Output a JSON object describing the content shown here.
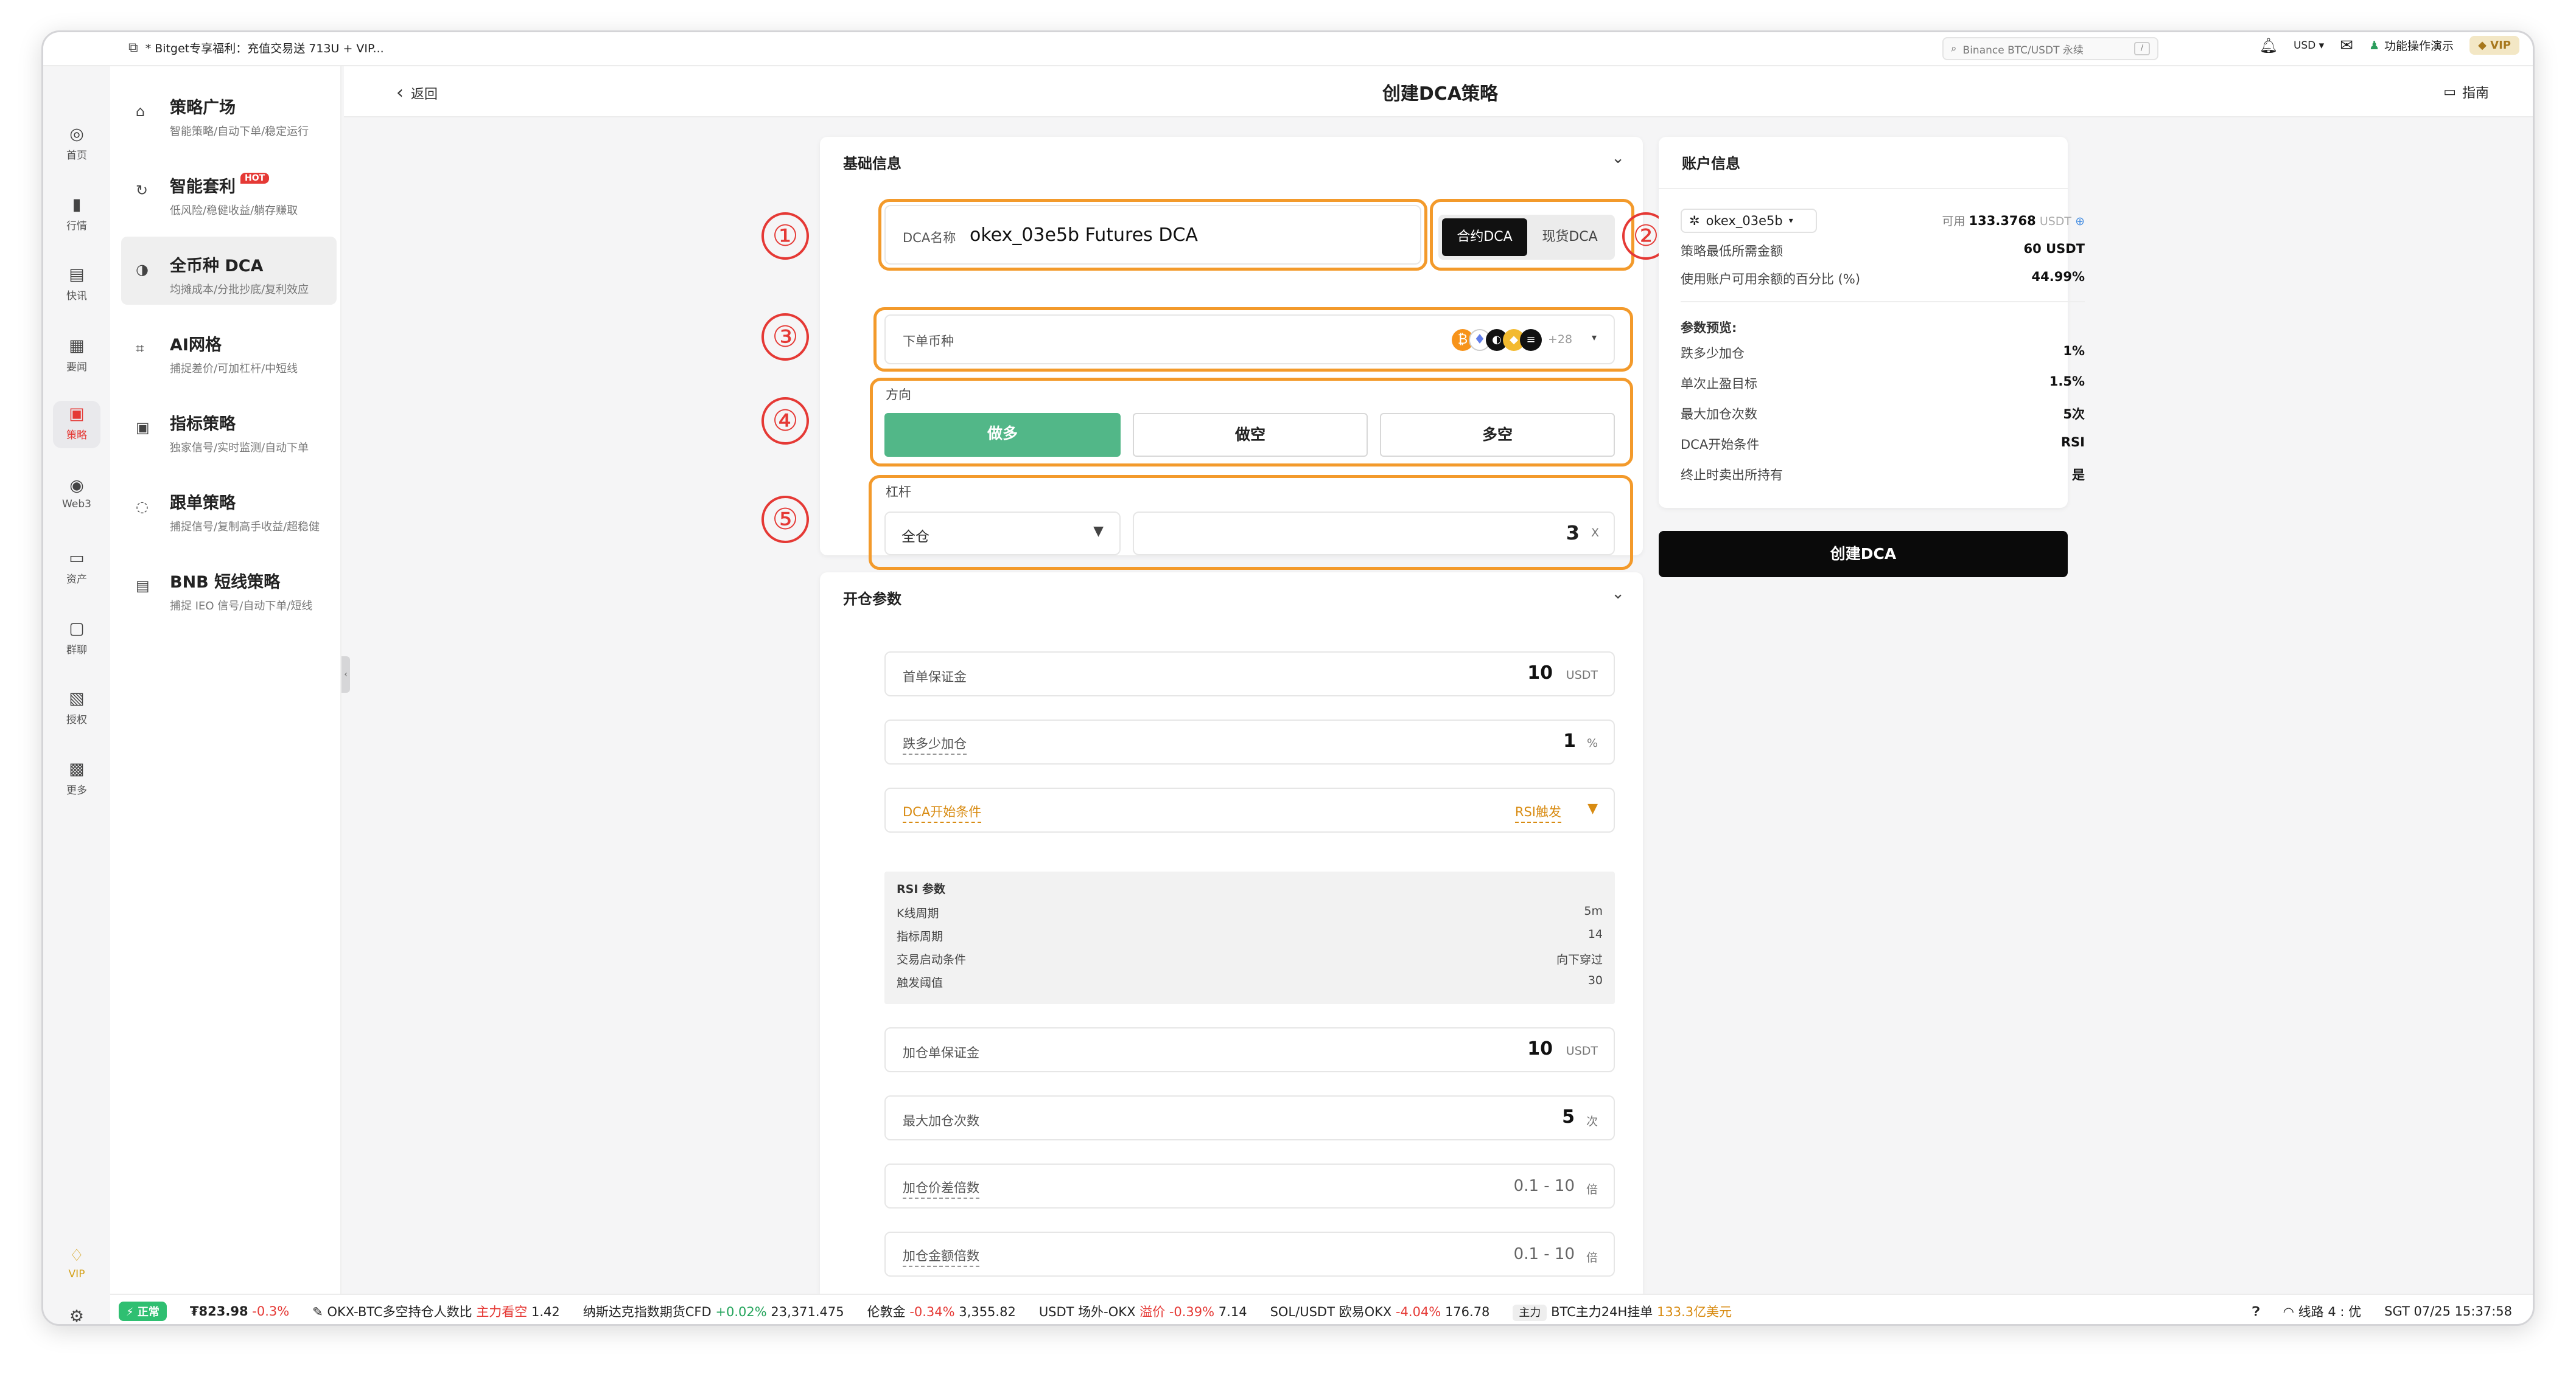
{
  "topbar": {
    "notice": "* Bitget专享福利：充值交易送 713U + VIP...",
    "search_placeholder": "Binance BTC/USDT 永续",
    "search_kbd": "/",
    "currency": "USD",
    "demo": "功能操作演示",
    "vip": "VIP"
  },
  "rail": [
    {
      "icon": "home-icon",
      "glyph": "◎",
      "label": "首页"
    },
    {
      "icon": "market-icon",
      "glyph": "▮",
      "label": "行情"
    },
    {
      "icon": "news-icon",
      "glyph": "▤",
      "label": "快讯"
    },
    {
      "icon": "article-icon",
      "glyph": "▦",
      "label": "要闻"
    },
    {
      "icon": "strategy-icon",
      "glyph": "▣",
      "label": "策略"
    },
    {
      "icon": "web3-icon",
      "glyph": "◉",
      "label": "Web3"
    },
    {
      "icon": "wallet-icon",
      "glyph": "▭",
      "label": "资产"
    },
    {
      "icon": "chat-icon",
      "glyph": "▢",
      "label": "群聊"
    },
    {
      "icon": "auth-icon",
      "glyph": "▧",
      "label": "授权"
    },
    {
      "icon": "more-icon",
      "glyph": "▩",
      "label": "更多"
    }
  ],
  "rail_vip": "VIP",
  "menu": [
    {
      "title": "策略广场",
      "sub": "智能策略/自动下单/稳定运行",
      "hot": ""
    },
    {
      "title": "智能套利",
      "sub": "低风险/稳健收益/躺存赚取",
      "hot": "HOT"
    },
    {
      "title": "全币种 DCA",
      "sub": "均摊成本/分批抄底/复利效应",
      "hot": ""
    },
    {
      "title": "AI网格",
      "sub": "捕捉差价/可加杠杆/中短线",
      "hot": ""
    },
    {
      "title": "指标策略",
      "sub": "独家信号/实时监测/自动下单",
      "hot": ""
    },
    {
      "title": "跟单策略",
      "sub": "捕捉信号/复制高手收益/超稳健",
      "hot": ""
    },
    {
      "title": "BNB 短线策略",
      "sub": "捕捉 IEO 信号/自动下单/短线",
      "hot": ""
    }
  ],
  "header": {
    "back": "返回",
    "title": "创建DCA策略",
    "guide": "指南"
  },
  "basic": {
    "title": "基础信息",
    "name_label": "DCA名称",
    "name_value": "okex_03e5b Futures DCA",
    "type_active": "合约DCA",
    "type_inactive": "现货DCA",
    "coin_label": "下单币种",
    "coin_more": "+28",
    "direction_label": "方向",
    "dir_long": "做多",
    "dir_short": "做空",
    "dir_both": "多空",
    "leverage_label": "杠杆",
    "margin_mode": "全仓",
    "leverage_value": "3",
    "leverage_unit": "X"
  },
  "markers": [
    "①",
    "②",
    "③",
    "④",
    "⑤"
  ],
  "open": {
    "title": "开仓参数",
    "first_margin_label": "首单保证金",
    "first_margin_value": "10",
    "first_margin_unit": "USDT",
    "drop_label": "跌多少加仓",
    "drop_value": "1",
    "drop_unit": "%",
    "start_label": "DCA开始条件",
    "start_value": "RSI触发",
    "rsi_title": "RSI 参数",
    "rsi_rows": [
      {
        "k": "K线周期",
        "v": "5m"
      },
      {
        "k": "指标周期",
        "v": "14"
      },
      {
        "k": "交易启动条件",
        "v": "向下穿过"
      },
      {
        "k": "触发阈值",
        "v": "30"
      }
    ],
    "add_margin_label": "加仓单保证金",
    "add_margin_value": "10",
    "add_margin_unit": "USDT",
    "max_add_label": "最大加仓次数",
    "max_add_value": "5",
    "max_add_unit": "次",
    "price_mult_label": "加仓价差倍数",
    "price_mult_value": "0.1 - 10",
    "price_mult_unit": "倍",
    "amount_mult_label": "加仓金额倍数",
    "amount_mult_value": "0.1 - 10",
    "amount_mult_unit": "倍"
  },
  "account": {
    "title": "账户信息",
    "account_name": "okex_03e5b",
    "available_label": "可用",
    "available_value": "133.3768",
    "available_unit": "USDT",
    "rows": [
      {
        "k": "策略最低所需金额",
        "v": "60 USDT"
      },
      {
        "k": "使用账户可用余额的百分比 (%)",
        "v": "44.99%"
      }
    ],
    "preview_title": "参数预览:",
    "preview": [
      {
        "k": "跌多少加仓",
        "v": "1%"
      },
      {
        "k": "单次止盈目标",
        "v": "1.5%"
      },
      {
        "k": "最大加仓次数",
        "v": "5次"
      },
      {
        "k": "DCA开始条件",
        "v": "RSI"
      },
      {
        "k": "终止时卖出所持有",
        "v": "是"
      }
    ],
    "create_button": "创建DCA"
  },
  "ticker": {
    "status": "正常",
    "price1": "₮823.98",
    "chg1": "-0.3%",
    "item2_name": "OKX-BTC多空持仓人数比",
    "item2_tag": "主力看空",
    "item2_val": "1.42",
    "item3_name": "纳斯达克指数期货CFD",
    "item3_chg": "+0.02%",
    "item3_val": "23,371.475",
    "item4_name": "伦敦金",
    "item4_chg": "-0.34%",
    "item4_val": "3,355.82",
    "item5_name": "USDT 场外-OKX",
    "item5_tag": "溢价 -0.39%",
    "item5_val": "7.14",
    "item6_name": "SOL/USDT 欧易OKX",
    "item6_chg": "-4.04%",
    "item6_val": "176.78",
    "item7_chip": "主力",
    "item7_name": "BTC主力24H挂单",
    "item7_val": "133.3亿美元",
    "route": "线路 4 : 优",
    "time": "SGT 07/25 15:37:58"
  }
}
